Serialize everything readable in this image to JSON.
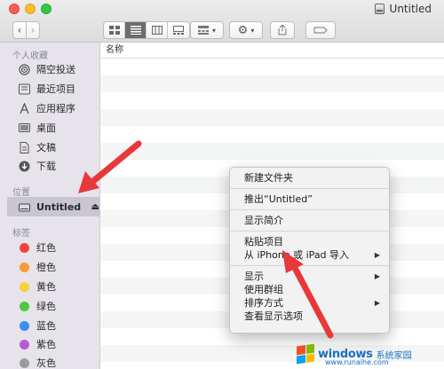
{
  "window": {
    "title": "Untitled"
  },
  "sidebar": {
    "favorites_header": "个人收藏",
    "favorites": [
      {
        "label": "隔空投送",
        "icon": "airdrop-icon"
      },
      {
        "label": "最近项目",
        "icon": "recents-icon"
      },
      {
        "label": "应用程序",
        "icon": "applications-icon"
      },
      {
        "label": "桌面",
        "icon": "desktop-icon"
      },
      {
        "label": "文稿",
        "icon": "documents-icon"
      },
      {
        "label": "下载",
        "icon": "downloads-icon"
      }
    ],
    "locations_header": "位置",
    "locations": [
      {
        "label": "Untitled",
        "icon": "drive-icon"
      }
    ],
    "tags_header": "标签",
    "tags": [
      {
        "label": "红色",
        "color": "#f2433f"
      },
      {
        "label": "橙色",
        "color": "#f79a38"
      },
      {
        "label": "黄色",
        "color": "#f8cf3c"
      },
      {
        "label": "绿色",
        "color": "#4cc93f"
      },
      {
        "label": "蓝色",
        "color": "#3b8df2"
      },
      {
        "label": "紫色",
        "color": "#b75bd5"
      },
      {
        "label": "灰色",
        "color": "#9c9c9e"
      }
    ]
  },
  "content": {
    "column_name": "名称"
  },
  "context_menu": {
    "items": [
      {
        "label": "新建文件夹",
        "submenu": false
      },
      {
        "label": "推出“Untitled”",
        "submenu": false
      },
      {
        "label": "显示简介",
        "submenu": false
      },
      {
        "label": "粘贴项目",
        "submenu": false
      },
      {
        "label": "从 iPhone 或 iPad 导入",
        "submenu": true
      },
      {
        "label": "显示",
        "submenu": true
      },
      {
        "label": "使用群组",
        "submenu": false
      },
      {
        "label": "排序方式",
        "submenu": true
      },
      {
        "label": "查看显示选项",
        "submenu": false
      }
    ]
  },
  "watermark": {
    "brand": "windows",
    "brand_cn": "系统家园",
    "url": "www.runaihe.com"
  },
  "colors": {
    "arrow": "#e8383a",
    "sidebar_bg": "#e6e3ea",
    "sidebar_selected": "#c9c6cf"
  }
}
